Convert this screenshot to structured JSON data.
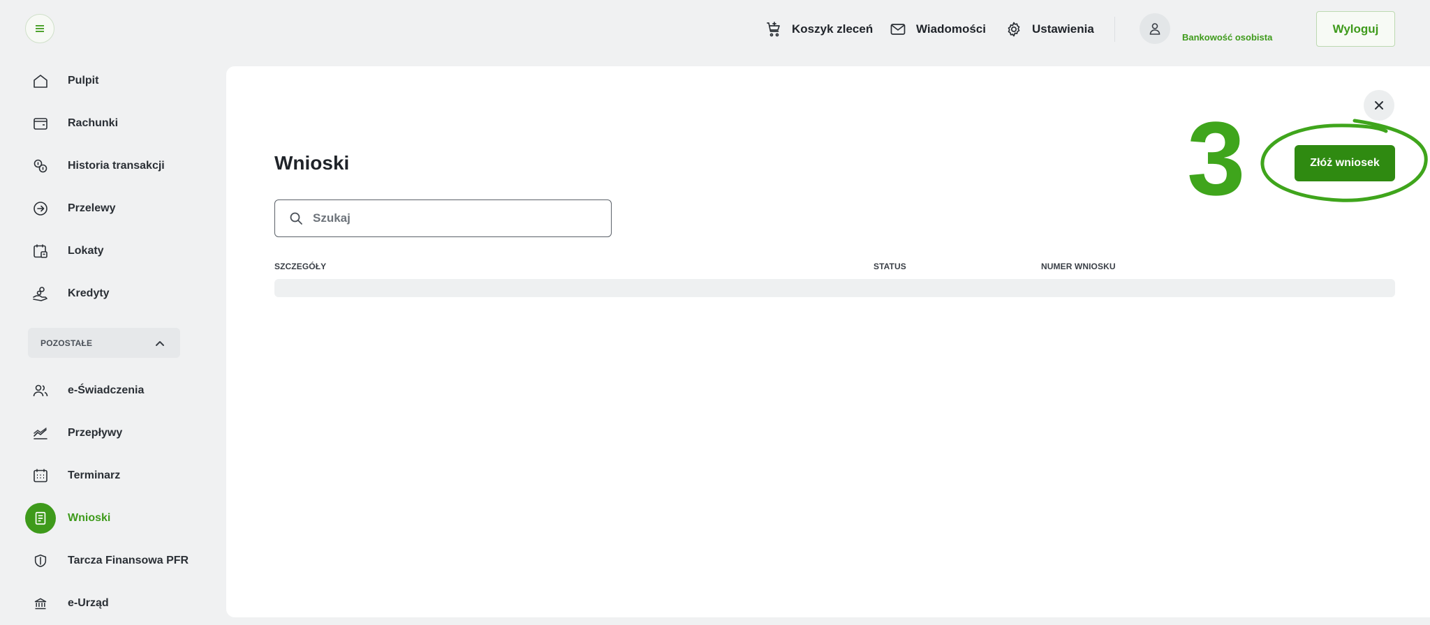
{
  "header": {
    "menu_icon": "hamburger-icon",
    "links": [
      {
        "label": "Koszyk zleceń",
        "icon": "cart-icon"
      },
      {
        "label": "Wiadomości",
        "icon": "envelope-icon"
      },
      {
        "label": "Ustawienia",
        "icon": "gear-icon"
      }
    ],
    "profile_label": "Bankowość osobista",
    "logout_label": "Wyloguj"
  },
  "sidebar": {
    "items": [
      {
        "label": "Pulpit",
        "icon": "home-icon"
      },
      {
        "label": "Rachunki",
        "icon": "wallet-icon"
      },
      {
        "label": "Historia transakcji",
        "icon": "coins-icon"
      },
      {
        "label": "Przelewy",
        "icon": "arrow-circle-icon"
      },
      {
        "label": "Lokaty",
        "icon": "calendar-deposit-icon"
      },
      {
        "label": "Kredyty",
        "icon": "hand-coins-icon"
      }
    ],
    "section_label": "POZOSTAŁE",
    "other_items": [
      {
        "label": "e-Świadczenia",
        "icon": "users-icon"
      },
      {
        "label": "Przepływy",
        "icon": "chart-line-icon"
      },
      {
        "label": "Terminarz",
        "icon": "calendar-icon"
      },
      {
        "label": "Wnioski",
        "icon": "document-icon",
        "active": true
      },
      {
        "label": "Tarcza Finansowa PFR",
        "icon": "shield-icon"
      },
      {
        "label": "e-Urząd",
        "icon": "government-icon"
      }
    ]
  },
  "main": {
    "title": "Wnioski",
    "search_placeholder": "Szukaj",
    "columns": [
      "SZCZEGÓŁY",
      "STATUS",
      "NUMER WNIOSKU"
    ],
    "submit_label": "Złóż wniosek"
  },
  "annotation": {
    "step_number": "3",
    "color": "#3fa51c"
  },
  "colors": {
    "accent": "#3e9a1b",
    "button": "#2f8a11",
    "background": "#f0f1f2"
  }
}
